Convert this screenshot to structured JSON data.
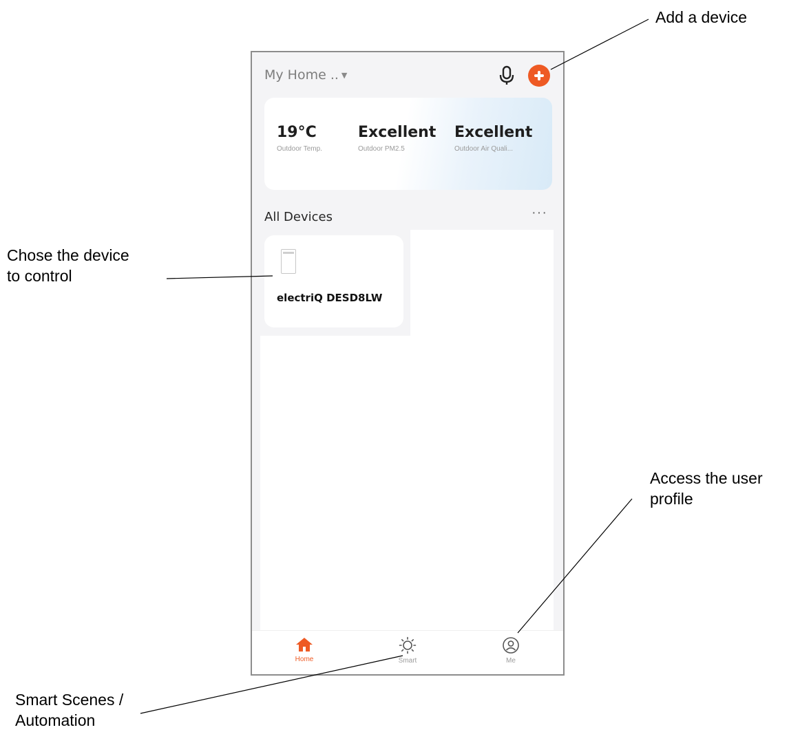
{
  "annotations": {
    "add_device": "Add a device",
    "choose_device": "Chose the device\nto control",
    "user_profile": "Access the user\nprofile",
    "smart_scenes": "Smart Scenes /\nAutomation"
  },
  "header": {
    "home_selector": "My Home ..",
    "mic_icon": "microphone-icon",
    "add_icon": "plus-circle-icon"
  },
  "weather": [
    {
      "value": "19°C",
      "label": "Outdoor Temp."
    },
    {
      "value": "Excellent",
      "label": "Outdoor PM2.5"
    },
    {
      "value": "Excellent",
      "label": "Outdoor Air Quali..."
    }
  ],
  "devices": {
    "section_title": "All Devices",
    "more": "···",
    "items": [
      {
        "name": "electriQ DESD8LW",
        "icon": "dehumidifier-icon"
      }
    ]
  },
  "tabs": [
    {
      "label": "Home",
      "icon": "home-icon",
      "active": true
    },
    {
      "label": "Smart",
      "icon": "sun-icon",
      "active": false
    },
    {
      "label": "Me",
      "icon": "user-icon",
      "active": false
    }
  ],
  "colors": {
    "accent": "#ee5a24",
    "background": "#f4f4f6"
  }
}
